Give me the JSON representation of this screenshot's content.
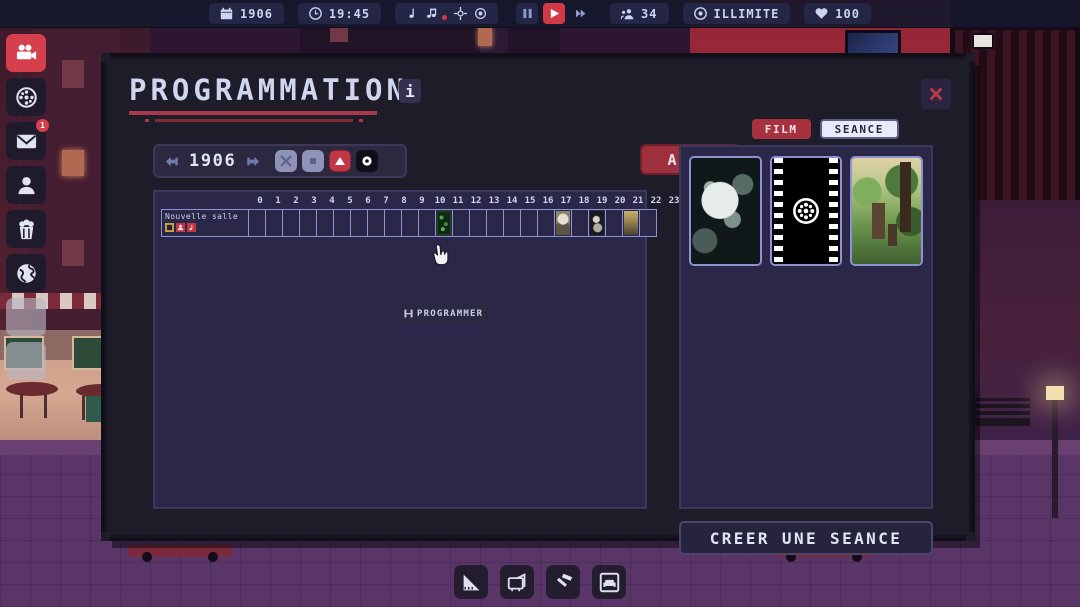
{
  "topbar": {
    "items": [
      {
        "icon": "calendar-icon",
        "value": "1906",
        "name": "year-indicator"
      },
      {
        "icon": "clock-icon",
        "value": "19:45",
        "name": "clock-indicator"
      }
    ],
    "music_icons": [
      "music-note-icon",
      "music-notes-icon",
      "target-icon",
      "circle-dot-icon"
    ],
    "speed": {
      "pause": "pause-icon",
      "play": "play-icon",
      "fast": "fast-forward-icon",
      "active": "play"
    },
    "audience": {
      "icon": "people-icon",
      "value": "34"
    },
    "money": {
      "icon": "coin-icon",
      "value": "ILLIMITE"
    },
    "popularity": {
      "icon": "heart-icon",
      "value": "100"
    }
  },
  "sidebar": {
    "items": [
      {
        "name": "sidebar-item-camera",
        "icon": "movie-camera-icon",
        "state": "active",
        "badge": null
      },
      {
        "name": "sidebar-item-reel",
        "icon": "film-reel-icon",
        "state": "normal",
        "badge": null
      },
      {
        "name": "sidebar-item-mail",
        "icon": "mail-icon",
        "state": "normal",
        "badge": "1"
      },
      {
        "name": "sidebar-item-staff",
        "icon": "person-icon",
        "state": "normal",
        "badge": null
      },
      {
        "name": "sidebar-item-concessions",
        "icon": "popcorn-icon",
        "state": "normal",
        "badge": null
      },
      {
        "name": "sidebar-item-world",
        "icon": "globe-icon",
        "state": "normal",
        "badge": null
      },
      {
        "name": "sidebar-item-locked-1",
        "icon": "blank-icon",
        "state": "ghost",
        "badge": null
      },
      {
        "name": "sidebar-item-locked-2",
        "icon": "blank-icon",
        "state": "ghost",
        "badge": null
      }
    ]
  },
  "bottombar": {
    "items": [
      {
        "name": "tool-build",
        "icon": "ruler-triangle-icon"
      },
      {
        "name": "tool-decorate",
        "icon": "tv-icon"
      },
      {
        "name": "tool-repair",
        "icon": "hammer-icon"
      },
      {
        "name": "tool-seating",
        "icon": "projector-icon"
      }
    ]
  },
  "modal": {
    "title": "PROGRAMMATION",
    "info_label": "i",
    "close_icon": "close-icon",
    "year_selector": {
      "prev_icon": "arrow-left-icon",
      "value": "1906",
      "next_icon": "arrow-right-icon",
      "filters": [
        {
          "name": "filter-shuffle",
          "icon": "shuffle-icon",
          "state": "dim"
        },
        {
          "name": "filter-stop",
          "icon": "square-icon",
          "state": "dim"
        },
        {
          "name": "filter-alert",
          "icon": "alert-icon",
          "state": "red"
        },
        {
          "name": "filter-target",
          "icon": "target-icon",
          "state": "dark"
        }
      ]
    },
    "auto_label": "AUTO",
    "schedule": {
      "hours": [
        "0",
        "1",
        "2",
        "3",
        "4",
        "5",
        "6",
        "7",
        "8",
        "9",
        "10",
        "11",
        "12",
        "13",
        "14",
        "15",
        "16",
        "17",
        "18",
        "19",
        "20",
        "21",
        "22",
        "23"
      ],
      "rooms": [
        {
          "name": "Nouvelle salle",
          "icons": [
            "seat-icon",
            "person-icon",
            "music-note-icon"
          ],
          "slots": [
            {
              "hour": 11,
              "thumb": "green"
            },
            {
              "hour": 18,
              "thumb": "portrait"
            },
            {
              "hour": 20,
              "thumb": "dark"
            },
            {
              "hour": 22,
              "thumb": "gold"
            }
          ]
        }
      ],
      "tooltip": {
        "icon": "schedule-icon",
        "label": "PROGRAMMER"
      }
    },
    "right_panel": {
      "tabs": [
        {
          "name": "tab-film",
          "label": "FILM",
          "active": true
        },
        {
          "name": "tab-seance",
          "label": "SEANCE",
          "active": false
        }
      ],
      "cards": [
        {
          "name": "film-card-moon",
          "art": "moon"
        },
        {
          "name": "film-card-strip",
          "art": "strip"
        },
        {
          "name": "film-card-forest",
          "art": "forest"
        }
      ],
      "create_label": "CREER UNE SEANCE"
    }
  },
  "colors": {
    "accent_red": "#c03746",
    "panel_navy": "#2a2748",
    "modal_dark": "#1e1c28",
    "text_light": "#cfd6ef"
  }
}
